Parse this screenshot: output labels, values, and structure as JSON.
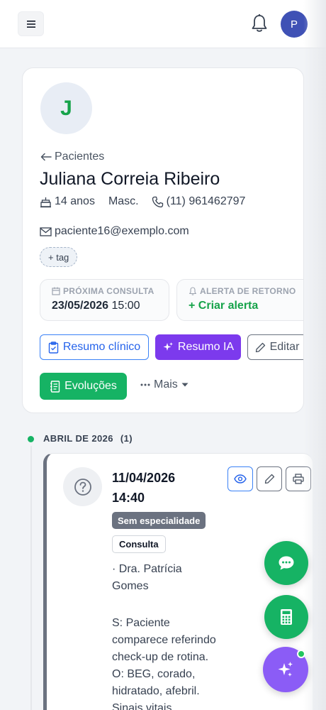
{
  "topbar": {
    "menu_icon": "hamburger-icon",
    "bell_icon": "bell-icon",
    "user_initial": "P"
  },
  "patient": {
    "initial": "J",
    "back_label": "Pacientes",
    "name": "Juliana Correia Ribeiro",
    "age": "14 anos",
    "sex": "Masc.",
    "phone": "(11) 961462797",
    "email": "paciente16@exemplo.com",
    "add_tag": "+ tag"
  },
  "next_appointment": {
    "label": "PRÓXIMA CONSULTA",
    "date": "23/05/2026",
    "time": "15:00"
  },
  "return_alert": {
    "label": "ALERTA DE RETORNO",
    "action": "+ Criar alerta"
  },
  "actions": {
    "clinical_summary": "Resumo clínico",
    "ai_summary": "Resumo IA",
    "edit": "Editar",
    "evolutions": "Evoluções",
    "more": "Mais"
  },
  "timeline": {
    "month_label": "ABRIL DE 2026",
    "month_count": "(1)",
    "entries": [
      {
        "date": "11/04/2026",
        "time": "14:40",
        "specialty": "Sem especialidade",
        "type": "Consulta",
        "doctor": "· Dra. Patrícia Gomes",
        "note": "S: Paciente comparece referindo check-up de rotina. O: BEG, corado, hidratado, afebril. Sinais vitais"
      }
    ]
  },
  "colors": {
    "accent_green": "#16b364",
    "accent_purple": "#7c3aed",
    "accent_blue": "#2563eb",
    "avatar_blue": "#3f51b5"
  }
}
